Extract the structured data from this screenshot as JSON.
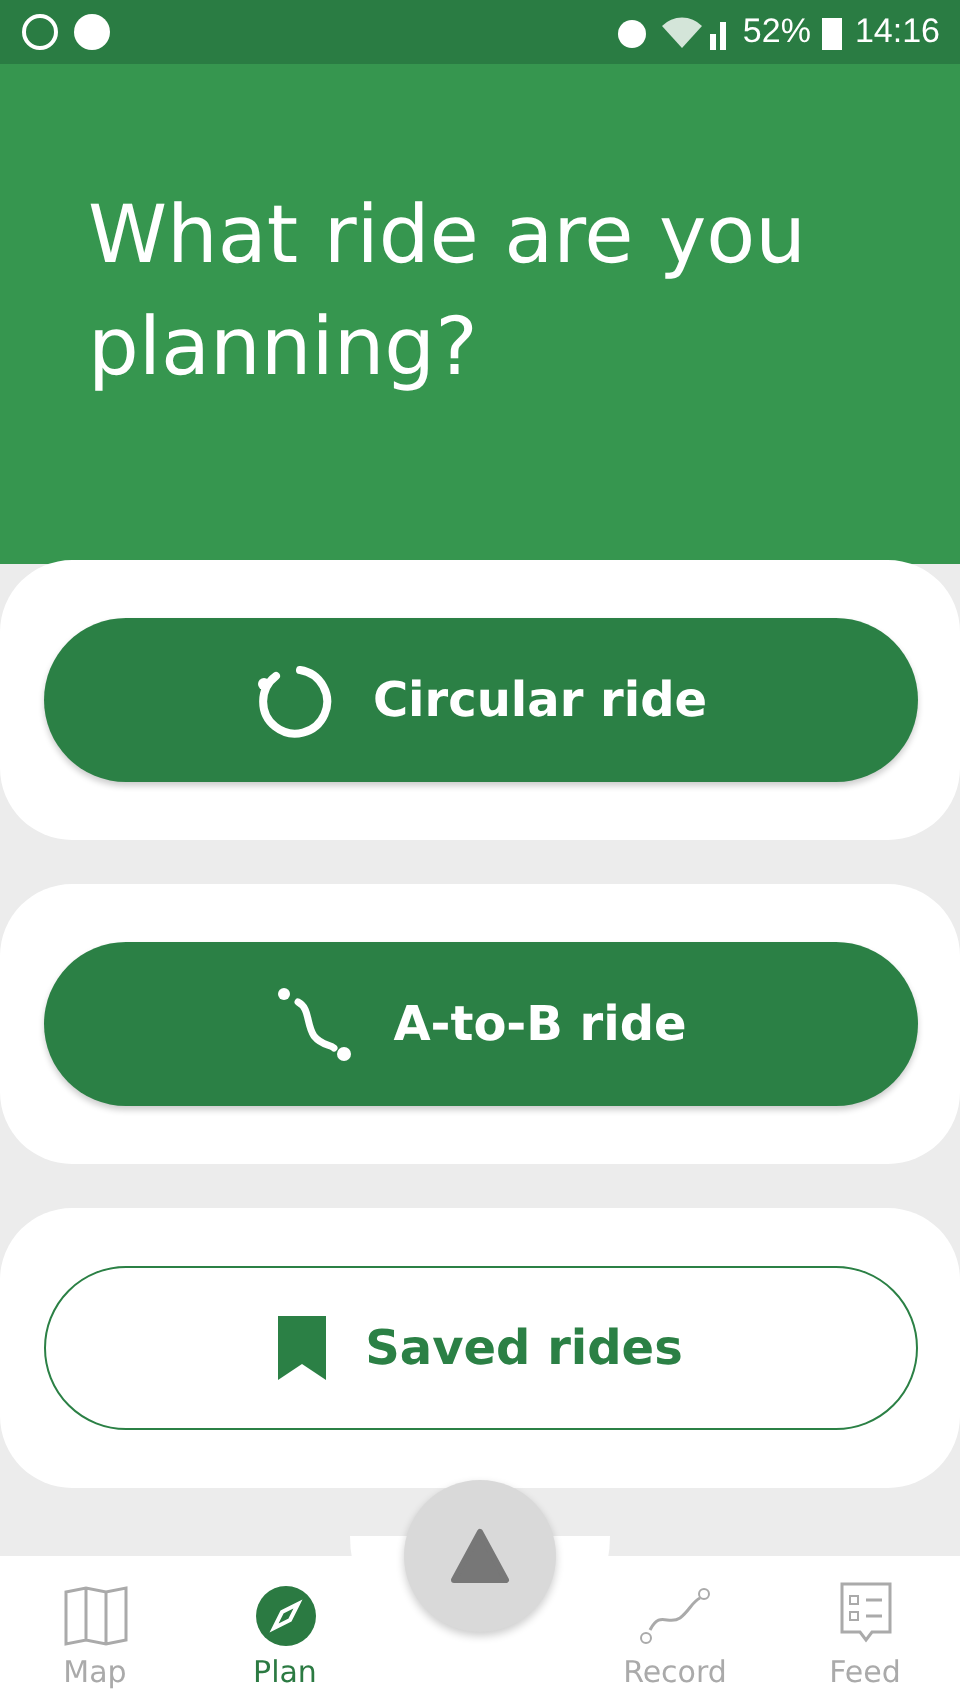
{
  "status_bar": {
    "battery": "52%",
    "time": "14:16"
  },
  "title": "What ride are you planning?",
  "options": [
    {
      "label": "Circular ride",
      "kind": "loop"
    },
    {
      "label": "A-to-B ride",
      "kind": "route"
    },
    {
      "label": "Saved rides",
      "kind": "saved"
    }
  ],
  "nav": [
    {
      "label": "Map",
      "kind": "map",
      "selected": false
    },
    {
      "label": "Plan",
      "kind": "compass",
      "selected": true
    },
    {
      "label": "Record",
      "kind": "record",
      "selected": false
    },
    {
      "label": "Feed",
      "kind": "feed",
      "selected": false
    }
  ]
}
